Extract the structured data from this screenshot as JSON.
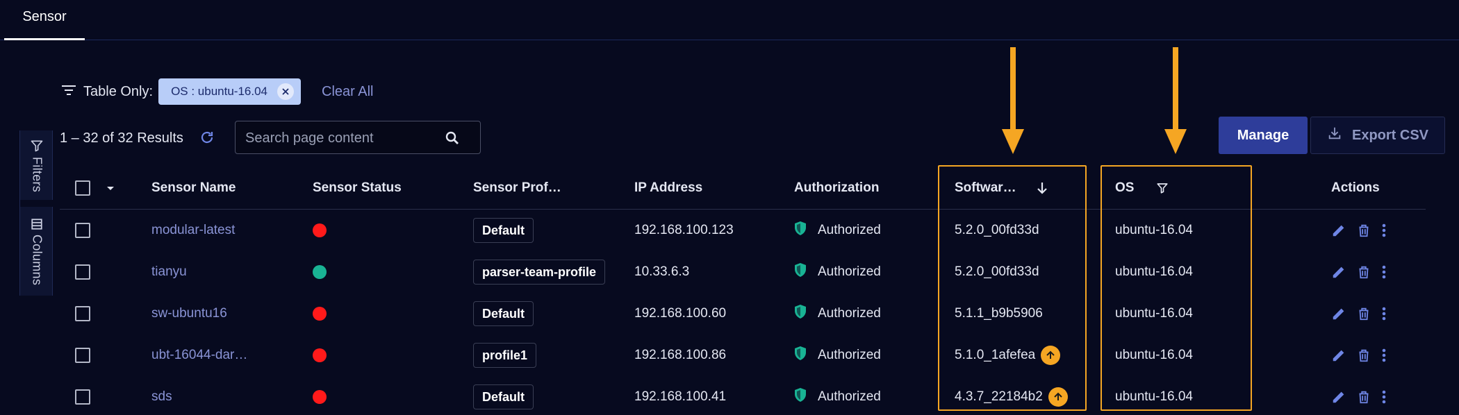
{
  "tabs": [
    {
      "label": "Sensor",
      "active": true
    }
  ],
  "side_panel": {
    "filters_label": "Filters",
    "columns_label": "Columns"
  },
  "filter_bar": {
    "label": "Table Only:",
    "chip_label": "OS : ubuntu-16.04",
    "clear_all_label": "Clear All"
  },
  "results": {
    "text": "1 – 32 of 32 Results"
  },
  "search": {
    "placeholder": "Search page content"
  },
  "toolbar": {
    "manage_label": "Manage",
    "export_label": "Export CSV"
  },
  "columns": [
    "Sensor Name",
    "Sensor Status",
    "Sensor Prof…",
    "IP Address",
    "Authorization",
    "Softwar…",
    "OS",
    "Actions"
  ],
  "rows": [
    {
      "name": "modular-latest",
      "status": "offline",
      "profile": "Default",
      "ip": "192.168.100.123",
      "authorization": "Authorized",
      "software": "5.2.0_00fd33d",
      "upgrade": false,
      "os": "ubuntu-16.04"
    },
    {
      "name": "tianyu",
      "status": "online",
      "profile": "parser-team-profile",
      "ip": "10.33.6.3",
      "authorization": "Authorized",
      "software": "5.2.0_00fd33d",
      "upgrade": false,
      "os": "ubuntu-16.04"
    },
    {
      "name": "sw-ubuntu16",
      "status": "offline",
      "profile": "Default",
      "ip": "192.168.100.60",
      "authorization": "Authorized",
      "software": "5.1.1_b9b5906",
      "upgrade": false,
      "os": "ubuntu-16.04"
    },
    {
      "name": "ubt-16044-dar…",
      "status": "offline",
      "profile": "profile1",
      "ip": "192.168.100.86",
      "authorization": "Authorized",
      "software": "5.1.0_1afefea",
      "upgrade": true,
      "os": "ubuntu-16.04"
    },
    {
      "name": "sds",
      "status": "offline",
      "profile": "Default",
      "ip": "192.168.100.41",
      "authorization": "Authorized",
      "software": "4.3.7_22184b2",
      "upgrade": true,
      "os": "ubuntu-16.04"
    }
  ],
  "colors": {
    "background": "#070a1f",
    "accent": "#2e3d9a",
    "link": "#8a94d6",
    "status_offline": "#ff1a1a",
    "status_online": "#19b394",
    "shield": "#19b394",
    "highlight": "#f5a623"
  },
  "icons": [
    "filter-lines-icon",
    "chip-close-icon",
    "refresh-icon",
    "search-icon",
    "download-icon",
    "funnel-icon",
    "columns-icon",
    "sort-down-icon",
    "chevron-down-icon",
    "shield-icon",
    "upgrade-icon",
    "edit-icon",
    "trash-icon",
    "more-vert-icon"
  ]
}
